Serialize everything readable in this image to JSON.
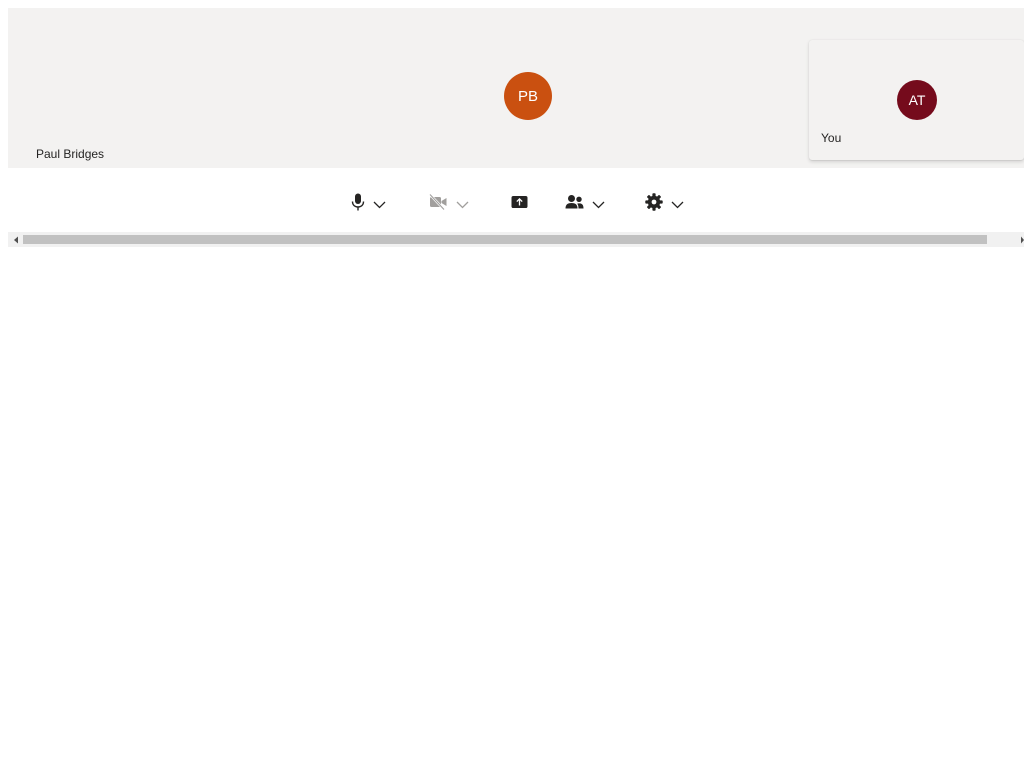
{
  "participants": {
    "remote": {
      "name": "Paul Bridges",
      "initials": "PB",
      "avatar_color": "#ca5010"
    },
    "local": {
      "name": "You",
      "initials": "AT",
      "avatar_color": "#750b1c"
    }
  },
  "controls": {
    "microphone": {
      "icon": "microphone-icon",
      "state": "on",
      "has_options": true
    },
    "camera": {
      "icon": "camera-off-icon",
      "state": "disabled",
      "has_options": true
    },
    "share": {
      "icon": "share-screen-icon"
    },
    "people": {
      "icon": "people-icon",
      "has_options": true
    },
    "settings": {
      "icon": "gear-icon",
      "has_options": true
    }
  },
  "colors": {
    "tile_background": "#f3f2f1",
    "icon_active": "#252423",
    "icon_disabled": "#a19f9d",
    "scrollbar_thumb": "#c1c1c1"
  }
}
